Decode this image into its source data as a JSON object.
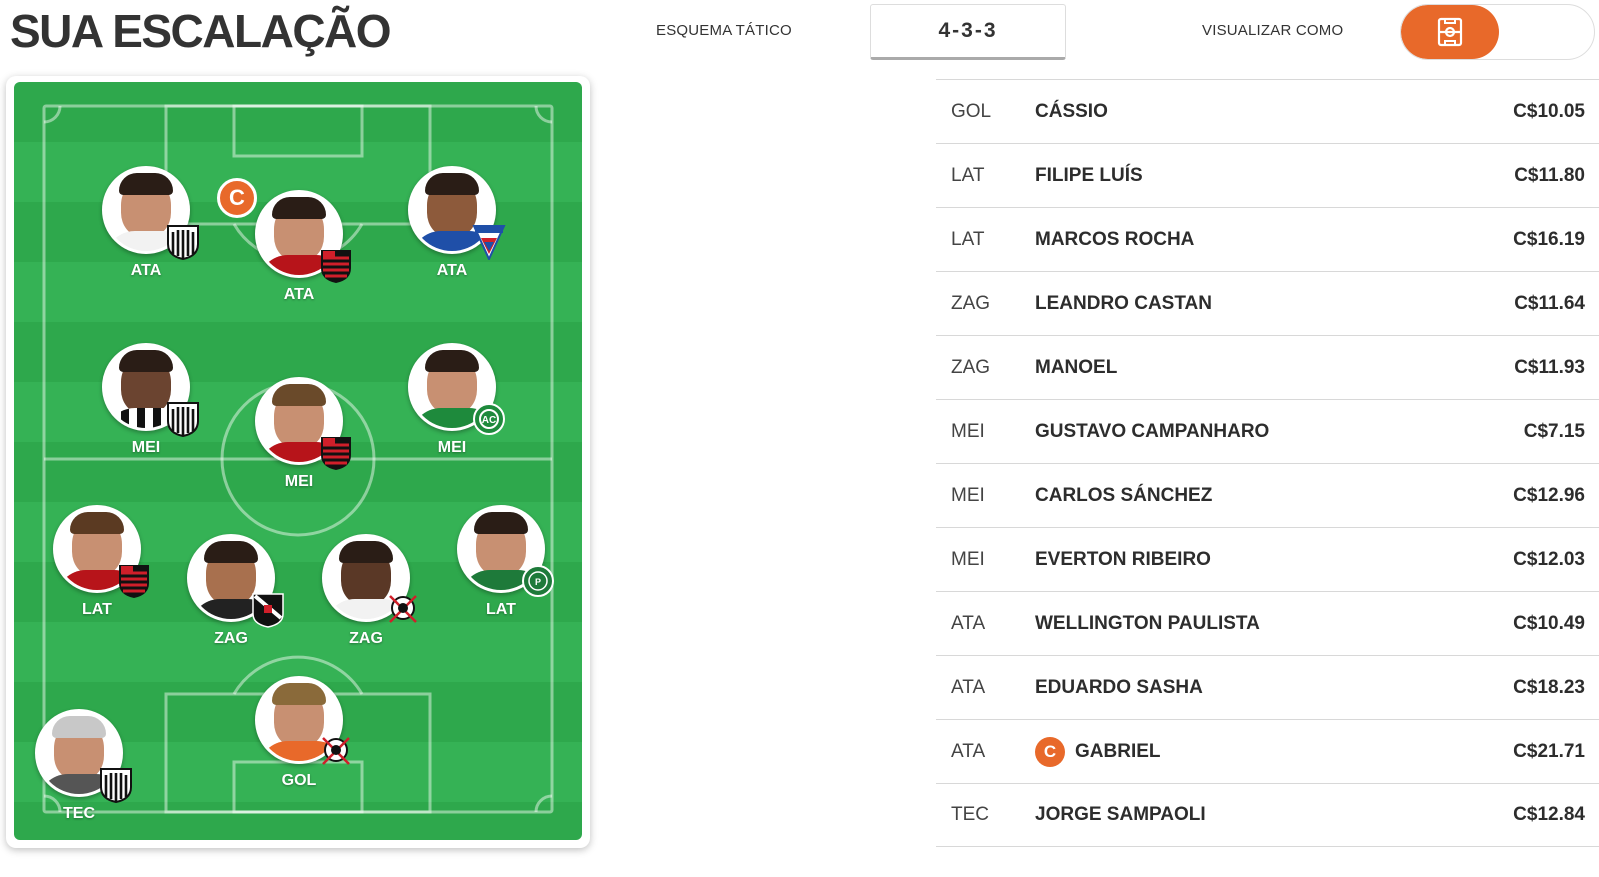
{
  "header": {
    "title": "SUA ESCALAÇÃO",
    "scheme_label": "ESQUEMA TÁTICO",
    "scheme_value": "4-3-3",
    "view_label": "VISUALIZAR COMO",
    "view_options": [
      "field-view-icon",
      "list-view-icon"
    ],
    "view_selected": "field-view-icon"
  },
  "colors": {
    "accent": "#e8692a",
    "pitch_dark": "#2ea84c",
    "pitch_light": "#35b255"
  },
  "pitch": {
    "captain_mark": "C",
    "players": [
      {
        "pos": "ATA",
        "club": "santos"
      },
      {
        "pos": "ATA",
        "club": "flamengo",
        "captain": true
      },
      {
        "pos": "ATA",
        "club": "fortaleza"
      },
      {
        "pos": "MEI",
        "club": "santos"
      },
      {
        "pos": "MEI",
        "club": "flamengo"
      },
      {
        "pos": "MEI",
        "club": "chapecoense"
      },
      {
        "pos": "LAT",
        "club": "flamengo"
      },
      {
        "pos": "ZAG",
        "club": "vasco"
      },
      {
        "pos": "ZAG",
        "club": "corinthians"
      },
      {
        "pos": "LAT",
        "club": "palmeiras"
      },
      {
        "pos": "GOL",
        "club": "corinthians"
      },
      {
        "pos": "TEC",
        "club": "santos"
      }
    ]
  },
  "lineup": [
    {
      "pos": "GOL",
      "name": "CÁSSIO",
      "price": "C$10.05"
    },
    {
      "pos": "LAT",
      "name": "FILIPE LUÍS",
      "price": "C$11.80"
    },
    {
      "pos": "LAT",
      "name": "MARCOS ROCHA",
      "price": "C$16.19"
    },
    {
      "pos": "ZAG",
      "name": "LEANDRO CASTAN",
      "price": "C$11.64"
    },
    {
      "pos": "ZAG",
      "name": "MANOEL",
      "price": "C$11.93"
    },
    {
      "pos": "MEI",
      "name": "GUSTAVO CAMPANHARO",
      "price": "C$7.15"
    },
    {
      "pos": "MEI",
      "name": "CARLOS SÁNCHEZ",
      "price": "C$12.96"
    },
    {
      "pos": "MEI",
      "name": "EVERTON RIBEIRO",
      "price": "C$12.03"
    },
    {
      "pos": "ATA",
      "name": "WELLINGTON PAULISTA",
      "price": "C$10.49"
    },
    {
      "pos": "ATA",
      "name": "EDUARDO SASHA",
      "price": "C$18.23"
    },
    {
      "pos": "ATA",
      "name": "GABRIEL",
      "price": "C$21.71",
      "captain": "C"
    },
    {
      "pos": "TEC",
      "name": "JORGE SAMPAOLI",
      "price": "C$12.84"
    }
  ]
}
